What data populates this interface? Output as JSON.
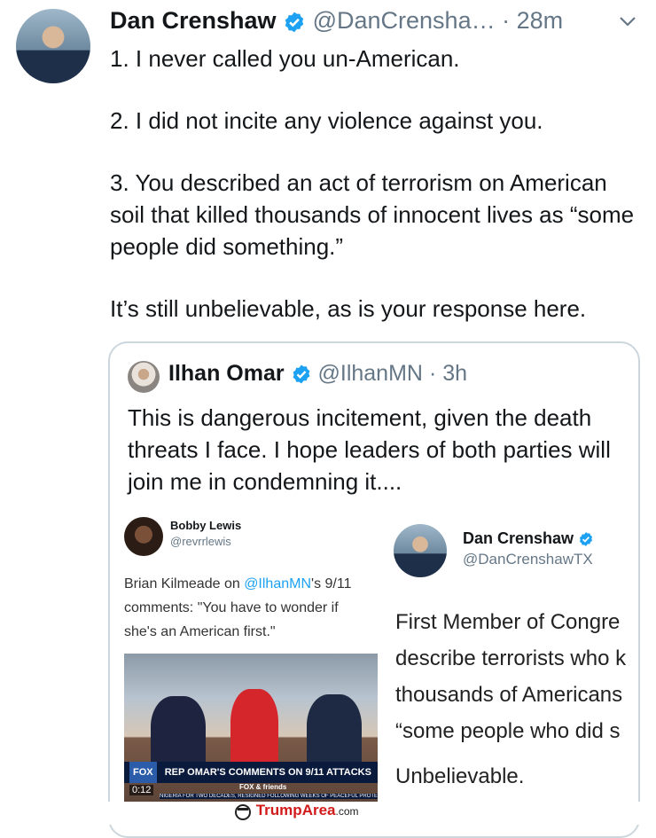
{
  "tweet": {
    "author_name": "Dan Crenshaw",
    "handle": "@DanCrensha…",
    "separator": "·",
    "time": "28m",
    "paragraphs": [
      "1. I never called you un-American.",
      "2. I did not incite any violence against you.",
      "3. You described an act of terrorism on American soil that killed thousands of innocent lives as “some people did something.”",
      "It’s still unbelievable, as is your response here."
    ],
    "menu_icon": "chevron-down-icon"
  },
  "quote": {
    "author_name": "Ilhan Omar",
    "handle": "@IlhanMN",
    "separator": "·",
    "time": "3h",
    "text": "This is dangerous incitement, given the death threats I face. I hope leaders of both parties will join me in condemning it...."
  },
  "left_screenshot": {
    "author_name": "Bobby Lewis",
    "handle": "@revrrlewis",
    "text_prefix": "Brian Kilmeade on ",
    "text_mention": "@IlhanMN",
    "text_suffix": "'s 9/11 comments: \"You have to wonder if she's an American first.\"",
    "video_time": "0:12",
    "chyron": "REP OMAR'S COMMENTS ON 9/11 ATTACKS",
    "network": "FOX",
    "program": "FOX & friends",
    "ticker": "NIGERIA FOR TWO DECADES, RESIGNED FOLLOWING WEEKS OF PEACEFUL PROTESTS CALLING F"
  },
  "right_screenshot": {
    "author_name": "Dan Crenshaw",
    "handle": "@DanCrenshawTX",
    "lines": [
      "First Member of Congre",
      "describe terrorists who k",
      "thousands of Americans",
      "“some people who did s"
    ],
    "closing": "Unbelievable."
  },
  "watermark": {
    "brand_a": "Trump",
    "brand_b": "Area",
    "tld": ".com"
  },
  "colors": {
    "verified_blue": "#1da1f2",
    "muted": "#657786",
    "link": "#1da1f2",
    "watermark_red": "#d21a1a"
  }
}
